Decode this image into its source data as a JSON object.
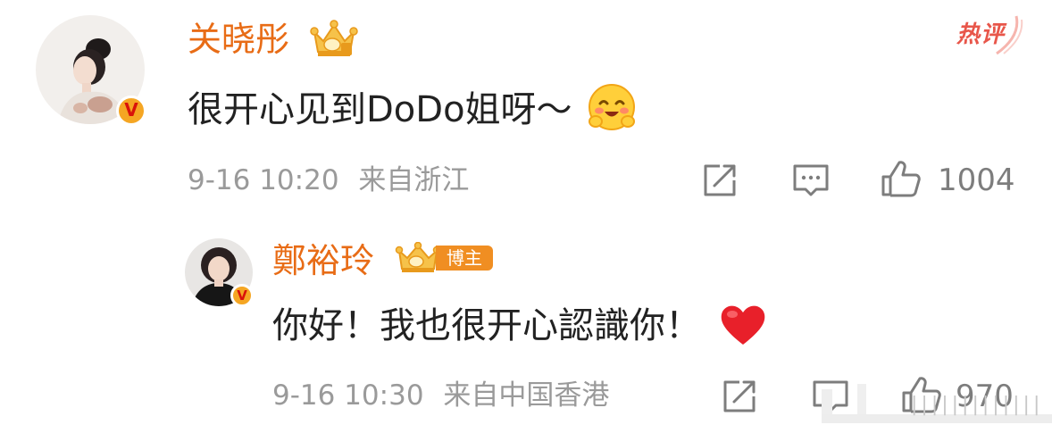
{
  "top_comment": {
    "username": "关晓彤",
    "text": "很开心见到DoDo姐呀～",
    "emoji": "smiling-blushing-face-emoji",
    "date": "9-16 10:20",
    "location": "来自浙江",
    "likes": "1004",
    "badge": "热评"
  },
  "reply": {
    "username": "鄭裕玲",
    "role_badge": "博主",
    "text": "你好！我也很开心認識你！",
    "emoji": "red-heart-emoji",
    "date": "9-16 10:30",
    "location": "来自中国香港",
    "likes": "970"
  },
  "watermark_text": "|||||||||||||",
  "verified_mark": "V",
  "colors": {
    "username": "#e86c16",
    "text": "#222222",
    "meta": "#9a9a9a",
    "hot_badge": "#e8564a",
    "verified_badge": "#f5a623"
  }
}
